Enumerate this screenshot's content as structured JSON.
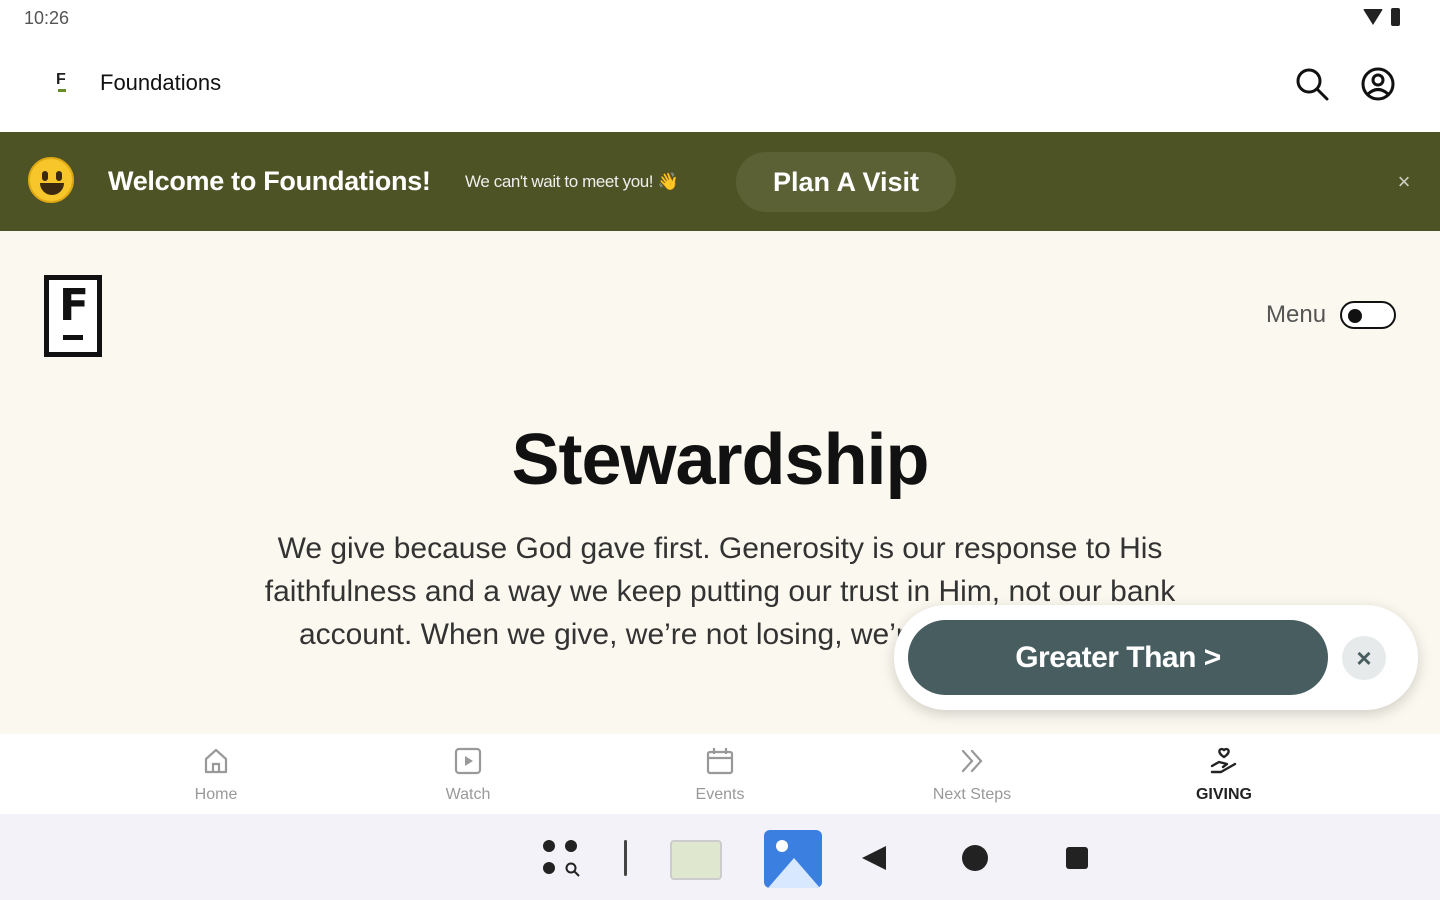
{
  "status_bar": {
    "time": "10:26"
  },
  "app_bar": {
    "logo_letter": "F",
    "title": "Foundations"
  },
  "banner": {
    "title": "Welcome to Foundations!",
    "subtitle": "We can't wait to meet you! 👋",
    "cta": "Plan A Visit",
    "close": "×",
    "background": "#4e5325"
  },
  "page": {
    "logo_letter": "F",
    "menu_label": "Menu",
    "title": "Stewardship",
    "body": "We give because God gave first. Generosity is our response to His faithfulness and a way we keep putting our trust in Him, not our bank account. When we give, we’re not losing, we’re growing in faith."
  },
  "floating": {
    "button": "Greater Than >",
    "close": "×",
    "color": "#475d60"
  },
  "bottom_nav": {
    "items": [
      {
        "label": "Home",
        "icon": "home-icon"
      },
      {
        "label": "Watch",
        "icon": "play-icon"
      },
      {
        "label": "Events",
        "icon": "calendar-icon"
      },
      {
        "label": "Next Steps",
        "icon": "double-chevron-icon"
      },
      {
        "label": "GIVING",
        "icon": "giving-hand-icon",
        "active": true
      }
    ]
  }
}
